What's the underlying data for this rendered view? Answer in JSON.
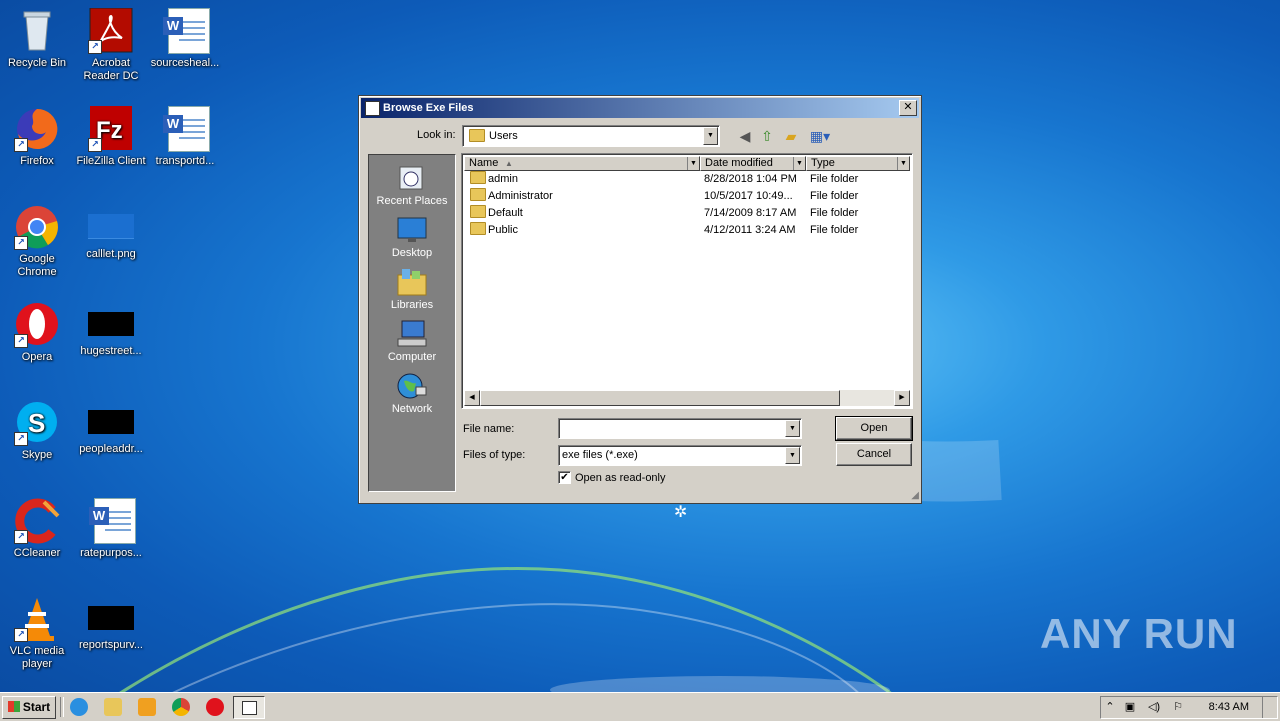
{
  "desktop": {
    "icons": [
      {
        "label": "Recycle Bin"
      },
      {
        "label": "Acrobat Reader DC"
      },
      {
        "label": "sourcesheal..."
      },
      {
        "label": "Firefox"
      },
      {
        "label": "FileZilla Client"
      },
      {
        "label": "transportd..."
      },
      {
        "label": "Google Chrome"
      },
      {
        "label": "calllet.png"
      },
      {
        "label": "Opera"
      },
      {
        "label": "hugestreet..."
      },
      {
        "label": "Skype"
      },
      {
        "label": "peopleaddr..."
      },
      {
        "label": "CCleaner"
      },
      {
        "label": "ratepurpos..."
      },
      {
        "label": "VLC media player"
      },
      {
        "label": "reportspurv..."
      }
    ],
    "watermark": "ANY RUN"
  },
  "dialog": {
    "title": "Browse Exe Files",
    "close_glyph": "✕",
    "look_in_label": "Look in:",
    "look_in_value": "Users",
    "places": [
      {
        "label": "Recent Places"
      },
      {
        "label": "Desktop"
      },
      {
        "label": "Libraries"
      },
      {
        "label": "Computer"
      },
      {
        "label": "Network"
      }
    ],
    "columns": {
      "name": "Name",
      "date": "Date modified",
      "type": "Type"
    },
    "files": [
      {
        "name": "admin",
        "date": "8/28/2018 1:04 PM",
        "type": "File folder"
      },
      {
        "name": "Administrator",
        "date": "10/5/2017 10:49...",
        "type": "File folder"
      },
      {
        "name": "Default",
        "date": "7/14/2009 8:17 AM",
        "type": "File folder"
      },
      {
        "name": "Public",
        "date": "4/12/2011 3:24 AM",
        "type": "File folder"
      }
    ],
    "file_name_label": "File name:",
    "file_name_value": "",
    "files_of_type_label": "Files of type:",
    "files_of_type_value": "exe files (*.exe)",
    "readonly_label": "Open as read-only",
    "readonly_checked": true,
    "open_button": "Open",
    "cancel_button": "Cancel"
  },
  "taskbar": {
    "start_label": "Start",
    "clock": "8:43 AM"
  },
  "colors": {
    "desktop_blue": "#1775cf",
    "dialog_face": "#d4d0c8",
    "titlebar_start": "#0a246a",
    "titlebar_end": "#a6caf0"
  }
}
